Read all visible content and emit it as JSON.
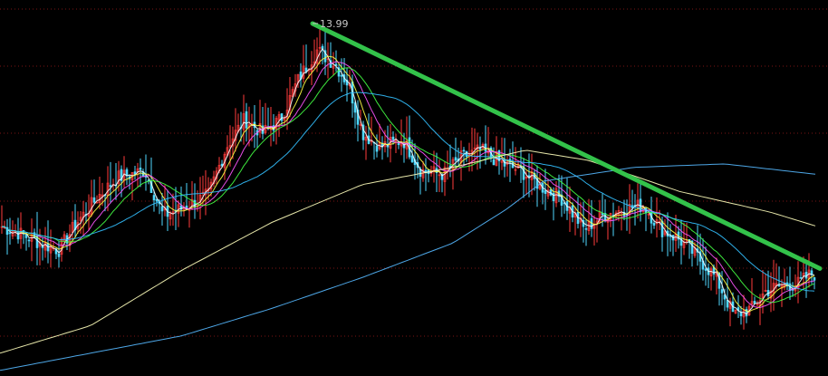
{
  "chart_data": {
    "type": "candlestick",
    "title": "",
    "xlabel": "",
    "ylabel": "",
    "ylim": [
      9.0,
      14.2
    ],
    "grid": true,
    "up_color": "#ff3b3b",
    "down_color": "#4fd8ff",
    "annotations": [
      {
        "text": "13.99",
        "bar": 345,
        "value": 13.99
      }
    ],
    "trendline": {
      "color": "#33c24a",
      "from": {
        "bar": 345,
        "value": 13.99
      },
      "to": {
        "bar": 905,
        "value": 10.43
      }
    },
    "closes_key": [
      [
        0,
        11.05
      ],
      [
        20,
        10.95
      ],
      [
        45,
        10.8
      ],
      [
        65,
        10.7
      ],
      [
        85,
        11.1
      ],
      [
        110,
        11.5
      ],
      [
        130,
        11.75
      ],
      [
        160,
        11.85
      ],
      [
        180,
        11.2
      ],
      [
        200,
        11.3
      ],
      [
        230,
        11.5
      ],
      [
        250,
        12.2
      ],
      [
        270,
        12.6
      ],
      [
        290,
        12.4
      ],
      [
        310,
        12.6
      ],
      [
        330,
        13.2
      ],
      [
        350,
        13.6
      ],
      [
        370,
        13.4
      ],
      [
        385,
        13.1
      ],
      [
        400,
        12.4
      ],
      [
        420,
        12.2
      ],
      [
        445,
        12.3
      ],
      [
        465,
        11.85
      ],
      [
        490,
        11.8
      ],
      [
        510,
        12.05
      ],
      [
        530,
        12.15
      ],
      [
        555,
        11.95
      ],
      [
        575,
        11.85
      ],
      [
        600,
        11.6
      ],
      [
        620,
        11.45
      ],
      [
        645,
        11.0
      ],
      [
        665,
        11.2
      ],
      [
        690,
        11.3
      ],
      [
        710,
        11.35
      ],
      [
        730,
        11.0
      ],
      [
        750,
        10.85
      ],
      [
        770,
        10.6
      ],
      [
        790,
        10.3
      ],
      [
        810,
        9.75
      ],
      [
        830,
        9.85
      ],
      [
        845,
        10.1
      ],
      [
        865,
        10.2
      ],
      [
        880,
        10.2
      ],
      [
        895,
        10.35
      ]
    ],
    "moving_averages": [
      {
        "period": 5,
        "color": "#ffffff"
      },
      {
        "period": 10,
        "color": "#ffff44"
      },
      {
        "period": 20,
        "color": "#ff55ff"
      },
      {
        "period": 30,
        "color": "#44ff44"
      },
      {
        "period": 60,
        "color": "#33c0ff"
      },
      {
        "period": 120,
        "color": "#ffffbb"
      },
      {
        "period": 250,
        "color": "#55b8ff"
      }
    ],
    "long_ma_key": {
      "120": [
        [
          0,
          9.2
        ],
        [
          100,
          9.6
        ],
        [
          200,
          10.4
        ],
        [
          300,
          11.1
        ],
        [
          400,
          11.65
        ],
        [
          500,
          11.9
        ],
        [
          580,
          12.15
        ],
        [
          650,
          12.0
        ],
        [
          750,
          11.55
        ],
        [
          850,
          11.25
        ],
        [
          900,
          11.05
        ]
      ],
      "250": [
        [
          0,
          8.95
        ],
        [
          100,
          9.2
        ],
        [
          200,
          9.45
        ],
        [
          300,
          9.85
        ],
        [
          400,
          10.3
        ],
        [
          500,
          10.8
        ],
        [
          560,
          11.3
        ],
        [
          600,
          11.7
        ],
        [
          700,
          11.9
        ],
        [
          800,
          11.95
        ],
        [
          900,
          11.8
        ]
      ]
    }
  }
}
